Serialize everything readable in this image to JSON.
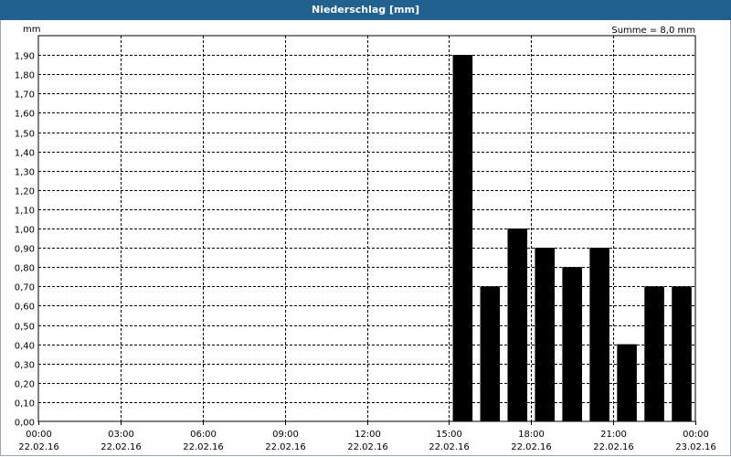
{
  "window": {
    "title": "Niederschlag [mm]"
  },
  "colors": {
    "title_bar": "#21618f",
    "bar": "#000000",
    "grid": "#000000"
  },
  "chart_data": {
    "type": "bar",
    "title": "Niederschlag [mm]",
    "ylabel": "mm",
    "annotation": "Summe = 8,0 mm",
    "ylim": [
      0,
      2.0
    ],
    "yticks": [
      "0,00",
      "0,10",
      "0,20",
      "0,30",
      "0,40",
      "0,50",
      "0,60",
      "0,70",
      "0,80",
      "0,90",
      "1,00",
      "1,10",
      "1,20",
      "1,30",
      "1,40",
      "1,50",
      "1,60",
      "1,70",
      "1,80",
      "1,90"
    ],
    "xlim_hours": [
      0,
      24
    ],
    "xticks": [
      {
        "time": "00:00",
        "date": "22.02.16"
      },
      {
        "time": "03:00",
        "date": "22.02.16"
      },
      {
        "time": "06:00",
        "date": "22.02.16"
      },
      {
        "time": "09:00",
        "date": "22.02.16"
      },
      {
        "time": "12:00",
        "date": "22.02.16"
      },
      {
        "time": "15:00",
        "date": "22.02.16"
      },
      {
        "time": "18:00",
        "date": "22.02.16"
      },
      {
        "time": "21:00",
        "date": "22.02.16"
      },
      {
        "time": "00:00",
        "date": "23.02.16"
      }
    ],
    "x": [
      "16:00",
      "17:00",
      "18:00",
      "19:00",
      "20:00",
      "21:00",
      "22:00",
      "23:00",
      "00:00"
    ],
    "values": [
      1.9,
      0.7,
      1.0,
      0.9,
      0.8,
      0.9,
      0.4,
      0.7,
      0.7
    ],
    "grid": true
  }
}
